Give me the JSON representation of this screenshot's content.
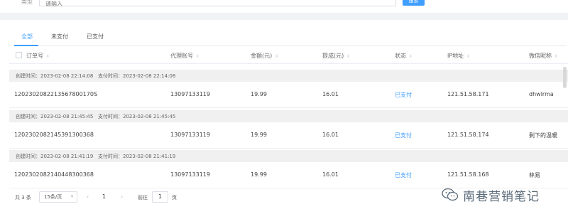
{
  "search": {
    "label": "类型",
    "placeholder": "请输入",
    "button": "搜索"
  },
  "tabs": [
    {
      "label": "全部",
      "active": true
    },
    {
      "label": "未支付",
      "active": false
    },
    {
      "label": "已支付",
      "active": false
    }
  ],
  "columns": {
    "order_no": "订单号",
    "agent": "代理账号",
    "amount": "金额(元)",
    "commission": "提成(元)",
    "status": "状态",
    "ip": "IP地址",
    "wechat": "微信昵称"
  },
  "groups": [
    {
      "created": "创建时间：2023-02-08 22:14:08",
      "paid": "支付时间：2023-02-08 22:14:08",
      "order_no": "1202302082213567800170S",
      "agent": "13097133119",
      "amount": "19.99",
      "commission": "16.01",
      "status": "已支付",
      "ip": "121.51.58.171",
      "wechat": "dhwlrma"
    },
    {
      "created": "创建时间：2023-02-08 21:45:45",
      "paid": "支付时间：2023-02-08 21:45:45",
      "order_no": "1202302082145391300368",
      "agent": "13097133119",
      "amount": "19.99",
      "commission": "16.01",
      "status": "已支付",
      "ip": "121.51.58.174",
      "wechat": "剩下的温暖"
    },
    {
      "created": "创建时间：2023-02-08 21:41:19",
      "paid": "支付时间：2023-02-08 21:41:19",
      "order_no": "1202302082140448300368",
      "agent": "13097133119",
      "amount": "19.99",
      "commission": "16.01",
      "status": "已支付",
      "ip": "121.51.58.168",
      "wechat": "林易"
    }
  ],
  "pagination": {
    "total": "共 3 条",
    "page_size": "15条/页",
    "current_page": "1",
    "goto_label": "前往",
    "goto_value": "1",
    "page_word": "页"
  },
  "watermark": {
    "text": "南巷营销笔记"
  },
  "colors": {
    "accent": "#409eff",
    "group_bg": "#f0f0f0"
  }
}
